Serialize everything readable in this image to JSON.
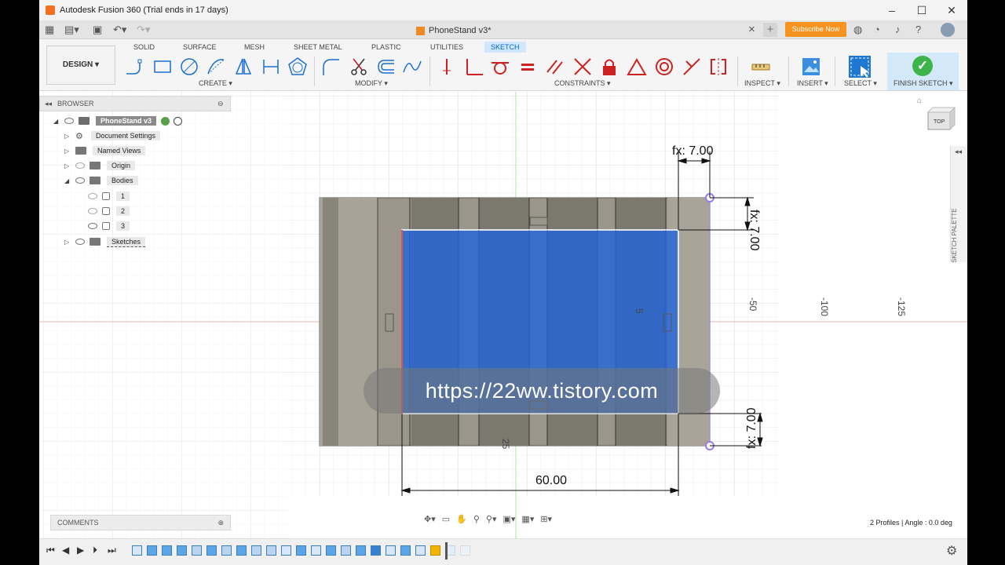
{
  "app": {
    "title": "Autodesk Fusion 360 (Trial ends in 17 days)",
    "window_controls": [
      "–",
      "☐",
      "✕"
    ]
  },
  "tabbar": {
    "doc_name": "PhoneStand v3*",
    "close_symbol": "×",
    "plus_symbol": "+",
    "subscribe_label": "Subscribe Now"
  },
  "toolbar": {
    "design_label": "DESIGN ▾",
    "workspace_tabs": [
      "SOLID",
      "SURFACE",
      "MESH",
      "SHEET METAL",
      "PLASTIC",
      "UTILITIES",
      "SKETCH"
    ],
    "groups": {
      "create": "CREATE ▾",
      "modify": "MODIFY ▾",
      "constraints": "CONSTRAINTS ▾",
      "inspect": "INSPECT ▾",
      "insert": "INSERT ▾",
      "select": "SELECT ▾",
      "finish": "FINISH SKETCH ▾"
    },
    "accent": "#0a64c8",
    "finish_color": "#3cb449"
  },
  "browser": {
    "header": "BROWSER",
    "root": "PhoneStand v3",
    "items": [
      {
        "label": "Document Settings"
      },
      {
        "label": "Named Views"
      },
      {
        "label": "Origin"
      },
      {
        "label": "Bodies"
      },
      {
        "label": "1"
      },
      {
        "label": "2"
      },
      {
        "label": "3"
      },
      {
        "label": "Sketches"
      }
    ]
  },
  "comments": {
    "label": "COMMENTS"
  },
  "sketch": {
    "dimensions": {
      "top": "fx: 7.00",
      "right_top": "fx: 7.00",
      "right_bottom": "fx: 7.00",
      "width": "60.00"
    },
    "axis_labels": {
      "v50": "-50",
      "v100": "-100",
      "v125": "-125",
      "v25": "25",
      "v5": "5"
    },
    "profile_color": "#1e64dc",
    "body_color": "#9a9689"
  },
  "viewcube": {
    "label": "TOP"
  },
  "palette": {
    "label": "SKETCH PALETTE"
  },
  "watermark": {
    "text": "https://22ww.tistory.com"
  },
  "status": {
    "text": "2 Profiles | Angle : 0.0 deg"
  }
}
